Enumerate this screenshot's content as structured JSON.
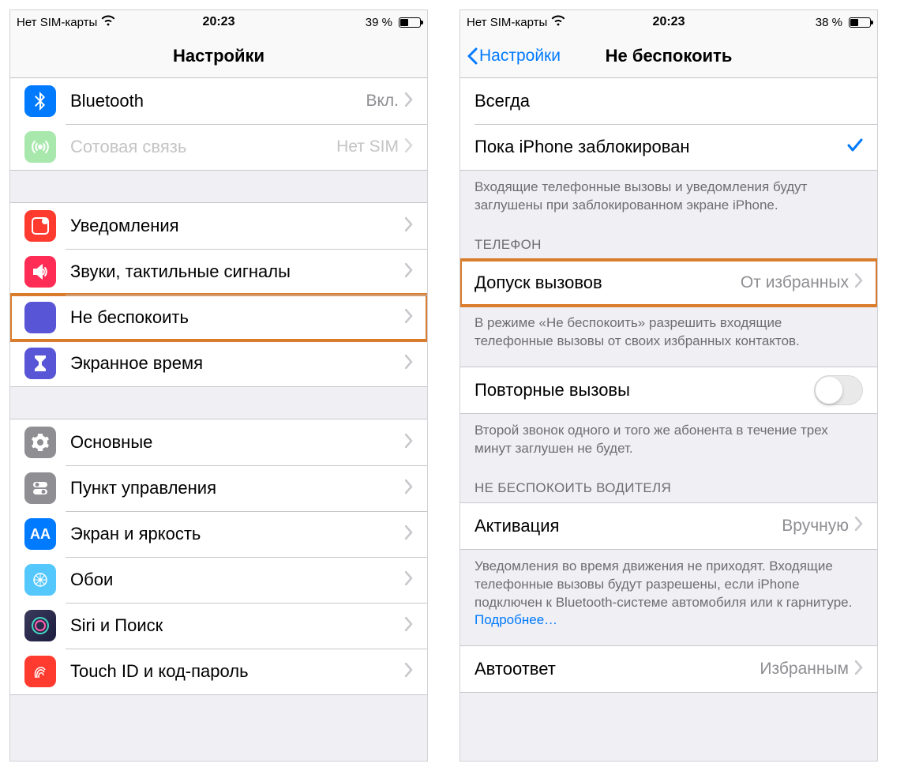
{
  "left": {
    "status": {
      "carrier": "Нет SIM-карты",
      "time": "20:23",
      "batteryText": "39 %",
      "batteryFill": 39
    },
    "title": "Настройки",
    "groups": [
      [
        {
          "key": "bluetooth",
          "label": "Bluetooth",
          "detail": "Вкл.",
          "iconColor": "#007aff"
        },
        {
          "key": "cellular",
          "label": "Сотовая связь",
          "detail": "Нет SIM",
          "iconColor": "#65d36e",
          "disabled": true
        }
      ],
      [
        {
          "key": "notifications",
          "label": "Уведомления",
          "iconColor": "#ff3b30"
        },
        {
          "key": "sounds",
          "label": "Звуки, тактильные сигналы",
          "iconColor": "#ff2d55"
        },
        {
          "key": "dnd",
          "label": "Не беспокоить",
          "iconColor": "#5856d6",
          "highlight": true
        },
        {
          "key": "screentime",
          "label": "Экранное время",
          "iconColor": "#5856d6"
        }
      ],
      [
        {
          "key": "general",
          "label": "Основные",
          "iconColor": "#8e8e93"
        },
        {
          "key": "controlcenter",
          "label": "Пункт управления",
          "iconColor": "#8e8e93"
        },
        {
          "key": "display",
          "label": "Экран и яркость",
          "iconColor": "#007aff"
        },
        {
          "key": "wallpaper",
          "label": "Обои",
          "iconColor": "#54c7fc"
        },
        {
          "key": "siri",
          "label": "Siri и Поиск",
          "iconColor": "#1c1c1e"
        },
        {
          "key": "touchid",
          "label": "Touch ID и код-пароль",
          "iconColor": "#ff3b30"
        }
      ]
    ]
  },
  "right": {
    "status": {
      "carrier": "Нет SIM-карты",
      "time": "20:23",
      "batteryText": "38 %",
      "batteryFill": 38,
      "showMoon": true
    },
    "back": "Настройки",
    "title": "Не беспокоить",
    "silence": {
      "always": "Всегда",
      "locked": "Пока iPhone заблокирован",
      "footer": "Входящие телефонные вызовы и уведомления будут заглушены при заблокированном экране iPhone."
    },
    "phone": {
      "header": "ТЕЛЕФОН",
      "allow": {
        "label": "Допуск вызовов",
        "detail": "От избранных",
        "highlight": true
      },
      "allowFooter": "В режиме «Не беспокоить» разрешить входящие телефонные вызовы от своих избранных контактов.",
      "repeat": {
        "label": "Повторные вызовы"
      },
      "repeatFooter": "Второй звонок одного и того же абонента в течение трех минут заглушен не будет."
    },
    "driving": {
      "header": "НЕ БЕСПОКОИТЬ ВОДИТЕЛЯ",
      "activation": {
        "label": "Активация",
        "detail": "Вручную"
      },
      "footer": "Уведомления во время движения не приходят. Входящие телефонные вызовы будут разрешены, если iPhone подключен к Bluetooth-системе автомобиля или к гарнитуре. ",
      "link": "Подробнее…",
      "autoreply": {
        "label": "Автоответ",
        "detail": "Избранным"
      }
    }
  }
}
